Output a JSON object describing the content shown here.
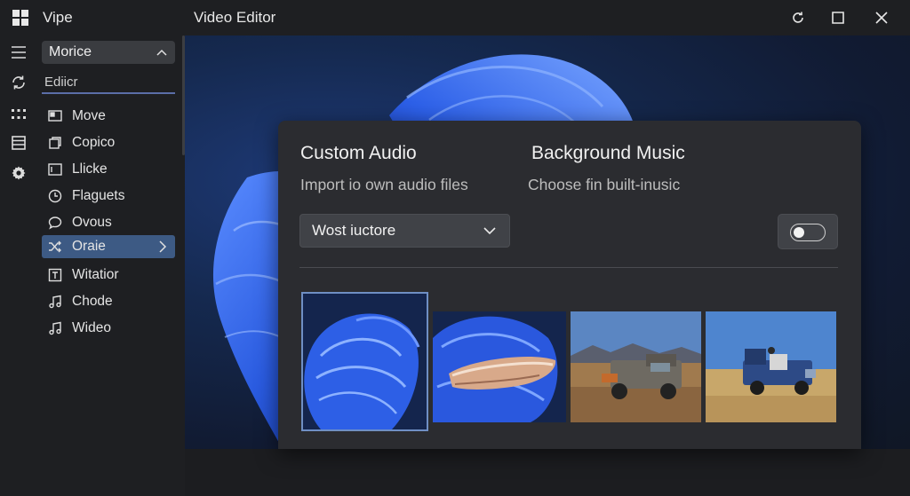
{
  "app": {
    "name": "Vipe",
    "window_title": "Video Editor"
  },
  "sidebar": {
    "section_select": "Morice",
    "search_value": "Ediicr",
    "items": [
      {
        "label": "Move",
        "icon": "monitor-icon"
      },
      {
        "label": "Copico",
        "icon": "copy-icon"
      },
      {
        "label": "Llicke",
        "icon": "frame-icon"
      },
      {
        "label": "Flaguets",
        "icon": "clock-icon"
      },
      {
        "label": "Ovous",
        "icon": "speech-bubble-icon"
      },
      {
        "label": "Oraie",
        "icon": "shuffle-icon",
        "active": true
      },
      {
        "label": "Witatior",
        "icon": "text-frame-icon"
      },
      {
        "label": "Chode",
        "icon": "music-note-icon"
      },
      {
        "label": "Wideo",
        "icon": "music-note-icon"
      }
    ]
  },
  "panel": {
    "custom_audio": {
      "title": "Custom Audio",
      "subtitle": "Import io own audio files",
      "dropdown_value": "Wost iuctore"
    },
    "background_music": {
      "title": "Background Music",
      "subtitle": "Choose fin built-inusic",
      "toggle_on": false
    },
    "thumbnails": [
      {
        "name": "blue-bloom-wallpaper",
        "selected": true
      },
      {
        "name": "bloom-with-food"
      },
      {
        "name": "desert-truck"
      },
      {
        "name": "desert-jeep-person"
      }
    ]
  },
  "colors": {
    "accent": "#3d5a84",
    "panel": "#2b2c30",
    "chrome": "#1e1f22",
    "bloom_blue": "#2f63e6"
  }
}
